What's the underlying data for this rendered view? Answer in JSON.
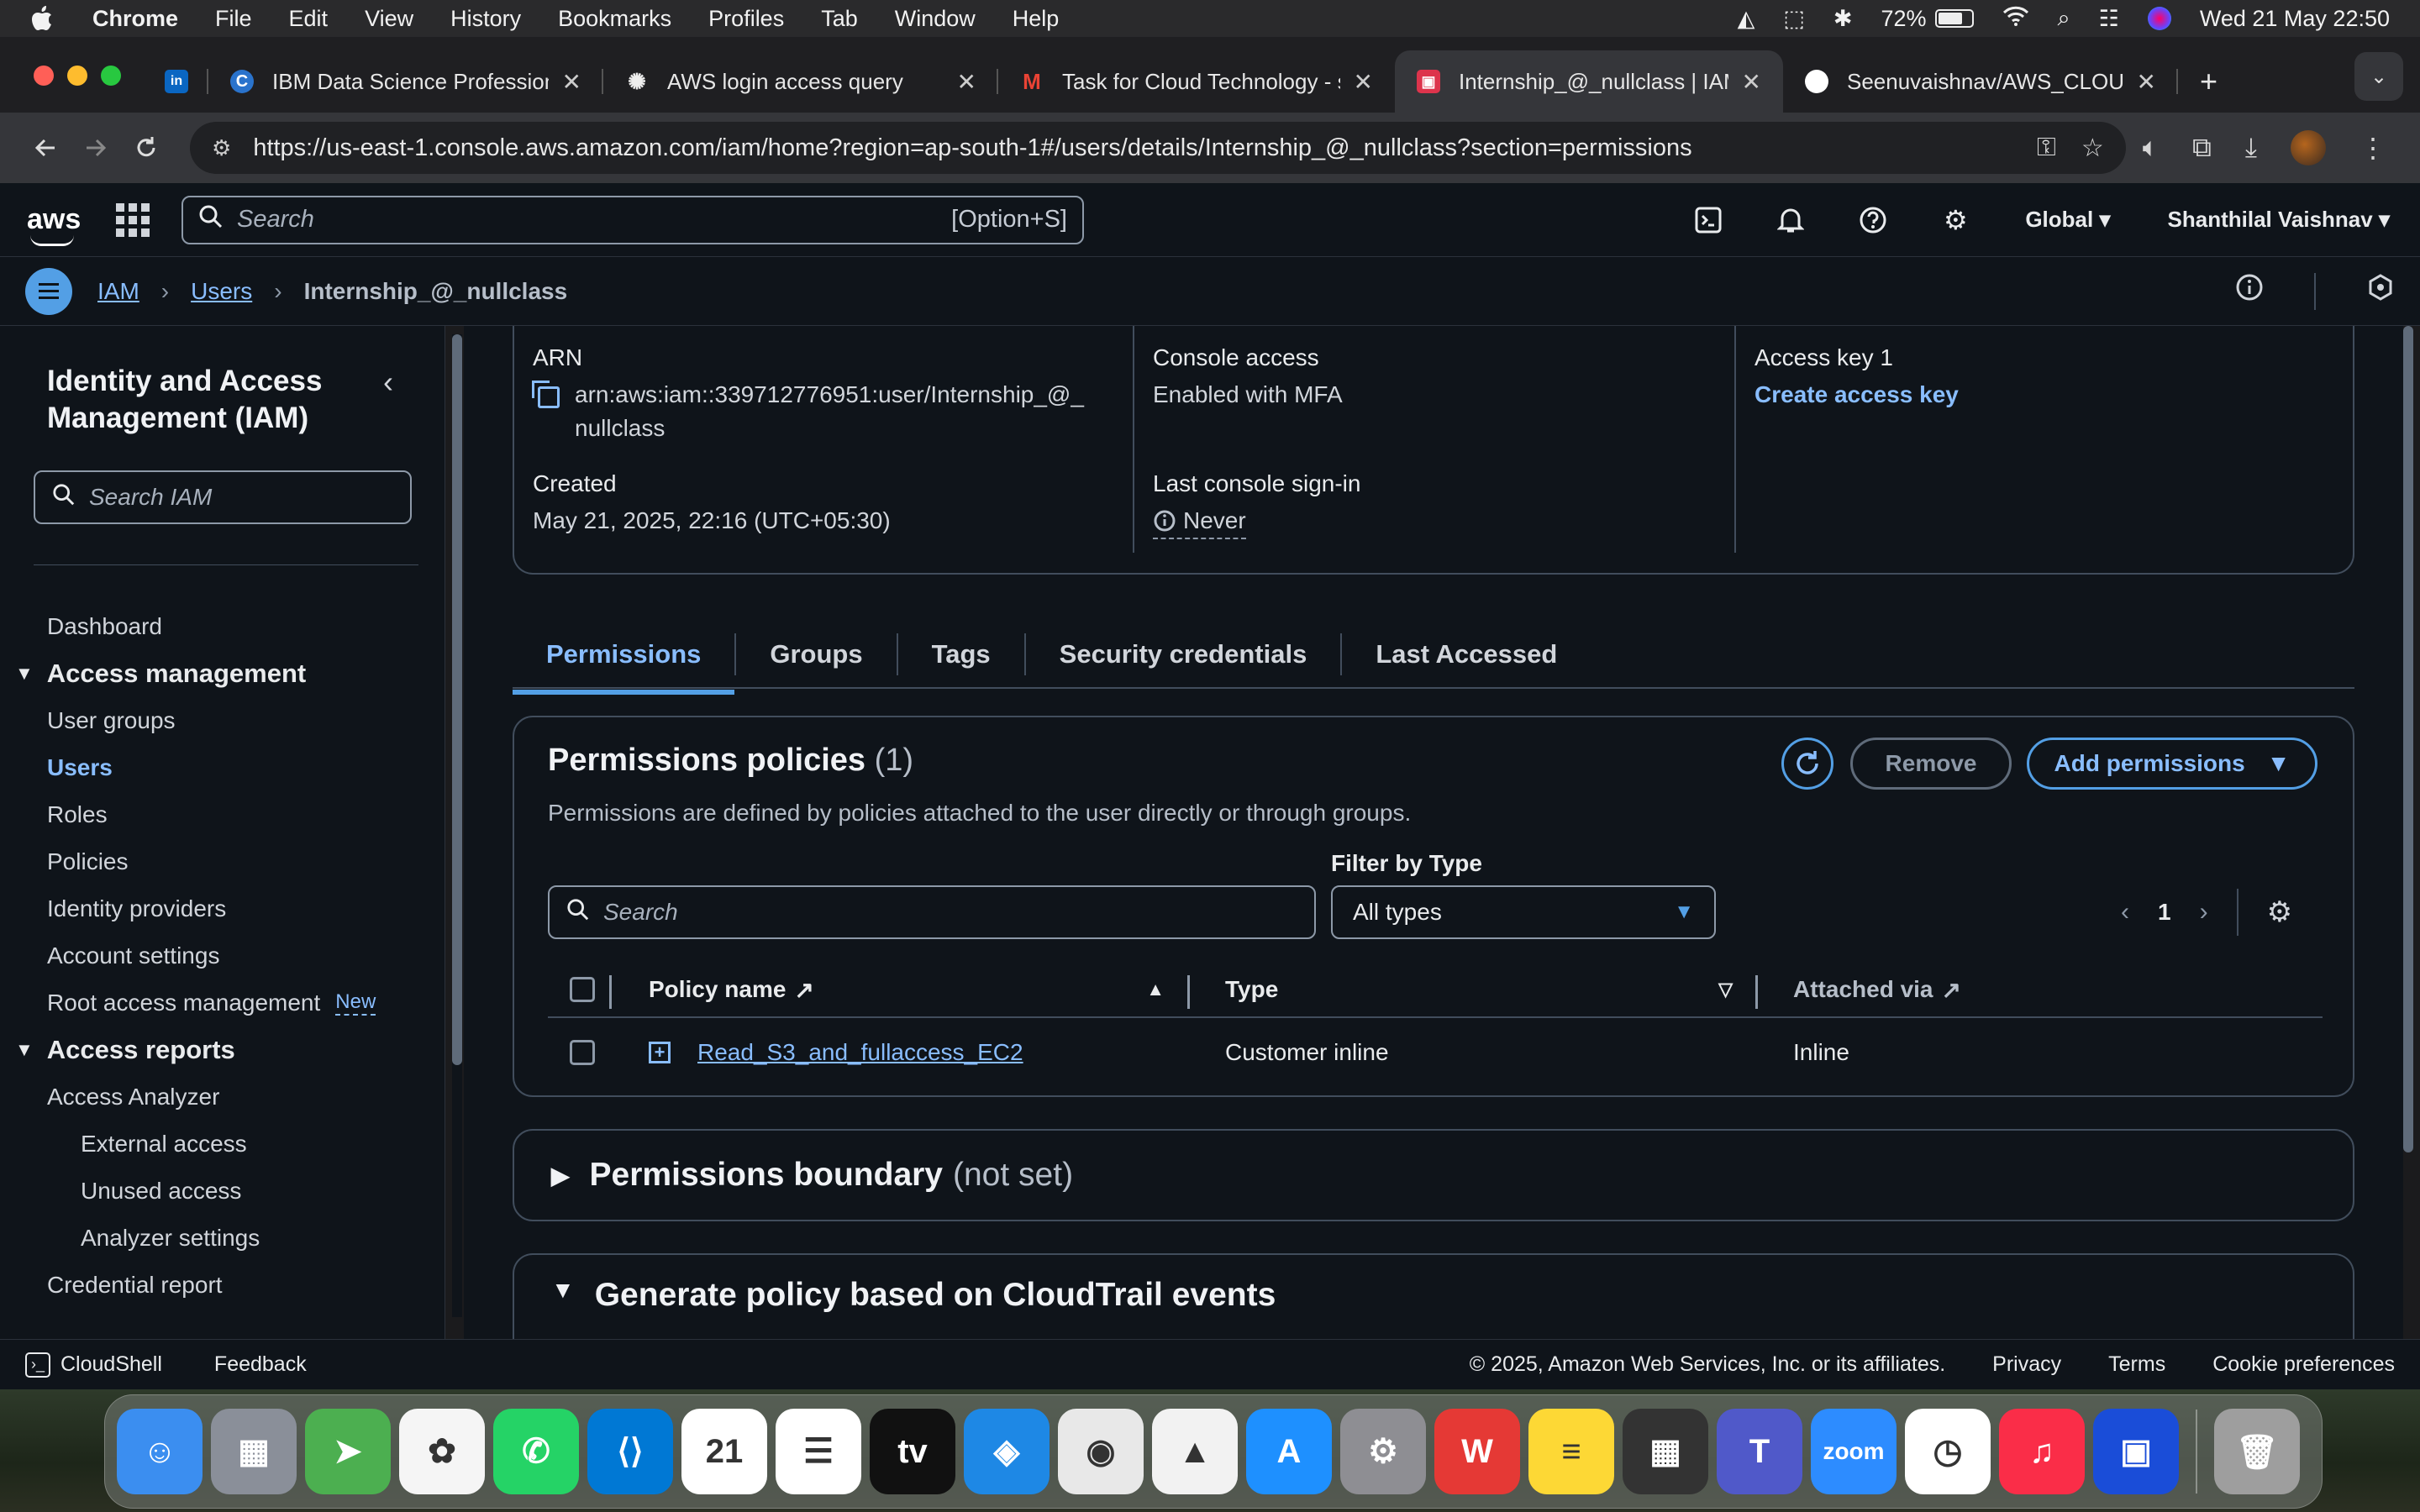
{
  "menubar": {
    "app": "Chrome",
    "items": [
      "File",
      "Edit",
      "View",
      "History",
      "Bookmarks",
      "Profiles",
      "Tab",
      "Window",
      "Help"
    ],
    "battery": "72%",
    "datetime": "Wed 21 May  22:50"
  },
  "tabs": [
    {
      "title": "",
      "favicon": "linkedin-icon",
      "color": "#0a66c2",
      "glyph": "in"
    },
    {
      "title": "IBM Data Science Professiona",
      "favicon": "coursera-icon",
      "color": "#2a73cc",
      "glyph": "C"
    },
    {
      "title": "AWS login access query",
      "favicon": "chatgpt-icon",
      "color": "#3a3a3a",
      "glyph": "✺"
    },
    {
      "title": "Task for Cloud Technology - s",
      "favicon": "gmail-icon",
      "color": "#ea4335",
      "glyph": "M"
    },
    {
      "title": "Internship_@_nullclass | IAM",
      "favicon": "aws-iam-icon",
      "color": "#dd344c",
      "glyph": "▣"
    },
    {
      "title": "Seenuvaishnav/AWS_CLOUD",
      "favicon": "github-icon",
      "color": "#ffffff",
      "glyph": "●"
    }
  ],
  "address_bar": {
    "url": "https://us-east-1.console.aws.amazon.com/iam/home?region=ap-south-1#/users/details/Internship_@_nullclass?section=permissions"
  },
  "aws_nav": {
    "logo": "aws",
    "search_placeholder": "Search",
    "search_shortcut": "[Option+S]",
    "region": "Global",
    "account": "Shanthilal Vaishnav"
  },
  "breadcrumb": {
    "items": [
      "IAM",
      "Users"
    ],
    "current": "Internship_@_nullclass"
  },
  "sidebar": {
    "title": "Identity and Access Management (IAM)",
    "search_placeholder": "Search IAM",
    "dashboard": "Dashboard",
    "section_access_management": "Access management",
    "access_management_items": [
      "User groups",
      "Users",
      "Roles",
      "Policies",
      "Identity providers",
      "Account settings",
      "Root access management"
    ],
    "new_badge": "New",
    "section_access_reports": "Access reports",
    "access_reports_items": [
      "Access Analyzer"
    ],
    "analyzer_items": [
      "External access",
      "Unused access",
      "Analyzer settings"
    ],
    "credential_report": "Credential report"
  },
  "summary": {
    "arn_label": "ARN",
    "arn_value": "arn:aws:iam::339712776951:user/Internship_@_nullclass",
    "arn_line1": "arn:aws:iam::339712776951:user/Internship_@_",
    "arn_line2": "nullclass",
    "created_label": "Created",
    "created_value": "May 21, 2025, 22:16 (UTC+05:30)",
    "console_access_label": "Console access",
    "console_access_value": "Enabled with MFA",
    "last_signin_label": "Last console sign-in",
    "last_signin_value": "Never",
    "access_key_label": "Access key 1",
    "access_key_link": "Create access key"
  },
  "user_tabs": [
    "Permissions",
    "Groups",
    "Tags",
    "Security credentials",
    "Last Accessed"
  ],
  "permissions": {
    "heading": "Permissions policies",
    "count": "(1)",
    "description": "Permissions are defined by policies attached to the user directly or through groups.",
    "remove_label": "Remove",
    "add_label": "Add permissions",
    "filter_label": "Filter by Type",
    "search_placeholder": "Search",
    "filter_value": "All types",
    "page": "1",
    "columns": [
      "Policy name",
      "Type",
      "Attached via"
    ],
    "rows": [
      {
        "name": "Read_S3_and_fullaccess_EC2",
        "type": "Customer inline",
        "attached": "Inline"
      }
    ]
  },
  "boundary": {
    "title": "Permissions boundary",
    "status": "(not set)"
  },
  "generate": {
    "title": "Generate policy based on CloudTrail events"
  },
  "footer": {
    "cloudshell": "CloudShell",
    "feedback": "Feedback",
    "copyright": "© 2025, Amazon Web Services, Inc. or its affiliates.",
    "links": [
      "Privacy",
      "Terms",
      "Cookie preferences"
    ]
  },
  "dock": [
    {
      "name": "finder-icon",
      "color": "#3b8ef0",
      "glyph": "☺"
    },
    {
      "name": "launchpad-icon",
      "color": "#8a8f99",
      "glyph": "▦"
    },
    {
      "name": "maps-icon",
      "color": "#4caf50",
      "glyph": "➤"
    },
    {
      "name": "photos-icon",
      "color": "#f5f5f5",
      "glyph": "✿"
    },
    {
      "name": "whatsapp-icon",
      "color": "#25d366",
      "glyph": "✆"
    },
    {
      "name": "vscode-icon",
      "color": "#0078d4",
      "glyph": "⟨⟩"
    },
    {
      "name": "calendar-icon",
      "color": "#ffffff",
      "glyph": "21"
    },
    {
      "name": "reminders-icon",
      "color": "#ffffff",
      "glyph": "☰"
    },
    {
      "name": "appletv-icon",
      "color": "#111111",
      "glyph": "tv"
    },
    {
      "name": "safari-icon",
      "color": "#1e88e5",
      "glyph": "◈"
    },
    {
      "name": "chrome-icon",
      "color": "#e8e8e8",
      "glyph": "◉"
    },
    {
      "name": "google-drive-icon",
      "color": "#f2f2f2",
      "glyph": "▲"
    },
    {
      "name": "app-store-icon",
      "color": "#1e90ff",
      "glyph": "A"
    },
    {
      "name": "system-settings-icon",
      "color": "#8e8e93",
      "glyph": "⚙"
    },
    {
      "name": "wps-office-icon",
      "color": "#e53935",
      "glyph": "W"
    },
    {
      "name": "notes-icon",
      "color": "#fdd835",
      "glyph": "≡"
    },
    {
      "name": "calculator-icon",
      "color": "#333333",
      "glyph": "▦"
    },
    {
      "name": "teams-icon",
      "color": "#5059c9",
      "glyph": "T"
    },
    {
      "name": "zoom-icon",
      "color": "#2d8cff",
      "glyph": "zoom"
    },
    {
      "name": "clock-icon",
      "color": "#ffffff",
      "glyph": "◷"
    },
    {
      "name": "music-icon",
      "color": "#fa2d48",
      "glyph": "♫"
    },
    {
      "name": "screen-sharing-icon",
      "color": "#1a4dd8",
      "glyph": "▣"
    },
    {
      "name": "trash-icon",
      "color": "#9e9e9e",
      "glyph": "🗑"
    }
  ]
}
